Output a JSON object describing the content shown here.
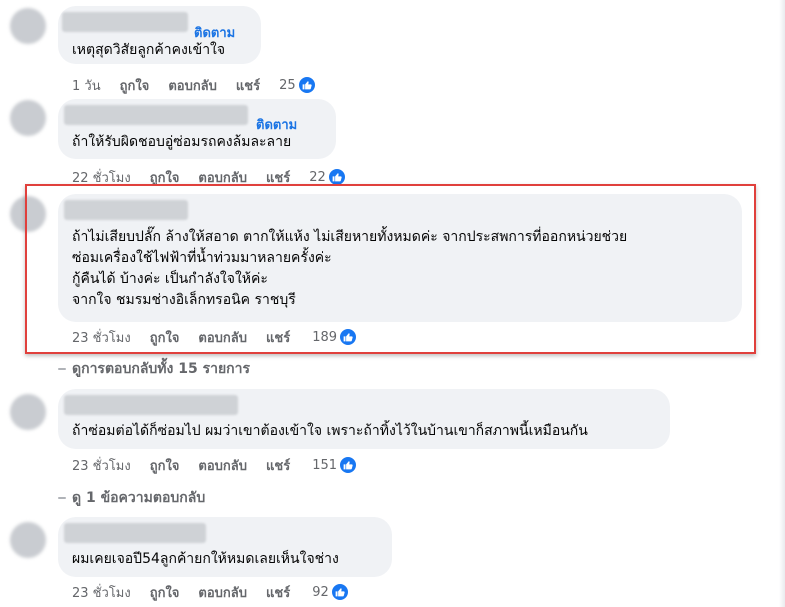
{
  "follow_label": "ติดตาม",
  "actions": {
    "like": "ถูกใจ",
    "reply": "ตอบกลับ",
    "share": "แชร์"
  },
  "comments": [
    {
      "text": [
        "เหตุสุดวิสัยลูกค้าคงเข้าใจ"
      ],
      "time": "1 วัน",
      "reactions": "25",
      "follow": true
    },
    {
      "text": [
        "ถ้าให้รับผิดชอบอู่ซ่อมรถคงล้มละลาย"
      ],
      "time": "22 ชั่วโมง",
      "reactions": "22",
      "follow": true
    },
    {
      "text": [
        "ถ้าไม่เสียบปลั๊ก ล้างให้สอาด ตากให้แห้ง ไม่เสียหายทั้งหมดค่ะ จากประสพการที่ออกหน่วยช่วย",
        "ซ่อมเครื่องใช้ไฟฟ้าที่น้ำท่วมมาหลายครั้งค่ะ",
        "กู้คืนได้ บ้างค่ะ เป็นกำลังใจให้ค่ะ",
        "จากใจ ชมรมช่างอิเล็กทรอนิค ราชบุรี"
      ],
      "time": "23 ชั่วโมง",
      "reactions": "189",
      "follow": false
    },
    {
      "text": [
        "ถ้าซ่อมต่อได้ก็ซ่อมไป ผมว่าเขาต้องเข้าใจ เพราะถ้าทิ้งไว้ในบ้านเขาก็สภาพนี้เหมือนกัน"
      ],
      "time": "23 ชั่วโมง",
      "reactions": "151",
      "follow": false
    },
    {
      "text": [
        "ผมเคยเจอปี54ลูกค้ายกให้หมดเลยเห็นใจช่าง"
      ],
      "time": "23 ชั่วโมง",
      "reactions": "92",
      "follow": false
    }
  ],
  "view_replies_1": "ดูการตอบกลับทั้ง 15 รายการ",
  "view_replies_2": "ดู 1 ข้อความตอบกลับ",
  "colors": {
    "link": "#1b74e4",
    "highlight": "#e0403c",
    "bubble": "#f0f2f5",
    "like": "#1877f2"
  },
  "icons": {
    "like": "thumbs-up-icon"
  }
}
